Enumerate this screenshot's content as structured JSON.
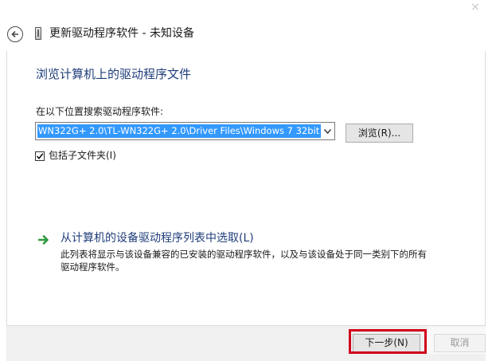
{
  "window": {
    "title": "更新驱动程序软件 - 未知设备",
    "close_glyph": "×"
  },
  "heading": "浏览计算机上的驱动程序文件",
  "search": {
    "label": "在以下位置搜索驱动程序软件:",
    "path_value": "WN322G+ 2.0\\TL-WN322G+ 2.0\\Driver Files\\Windows 7 32bit",
    "browse_label": "浏览(R)..."
  },
  "include_subfolders": {
    "label": "包括子文件夹(I)",
    "checked": true
  },
  "pick_from_list": {
    "title": "从计算机的设备驱动程序列表中选取(L)",
    "description": "此列表将显示与该设备兼容的已安装的驱动程序软件，以及与该设备处于同一类别下的所有驱动程序软件。"
  },
  "footer": {
    "next_label": "下一步(N)",
    "cancel_label": "取消"
  },
  "colors": {
    "heading_blue": "#1f3d7a",
    "selection_blue": "#3399ff",
    "link_arrow_green": "#2e9a3e",
    "highlight_red": "#d0021b"
  },
  "icons": {
    "back": "back-arrow-icon",
    "device": "device-icon",
    "combo": "chevron-down-icon",
    "checkbox": "checkmark-icon",
    "link": "green-arrow-icon"
  }
}
